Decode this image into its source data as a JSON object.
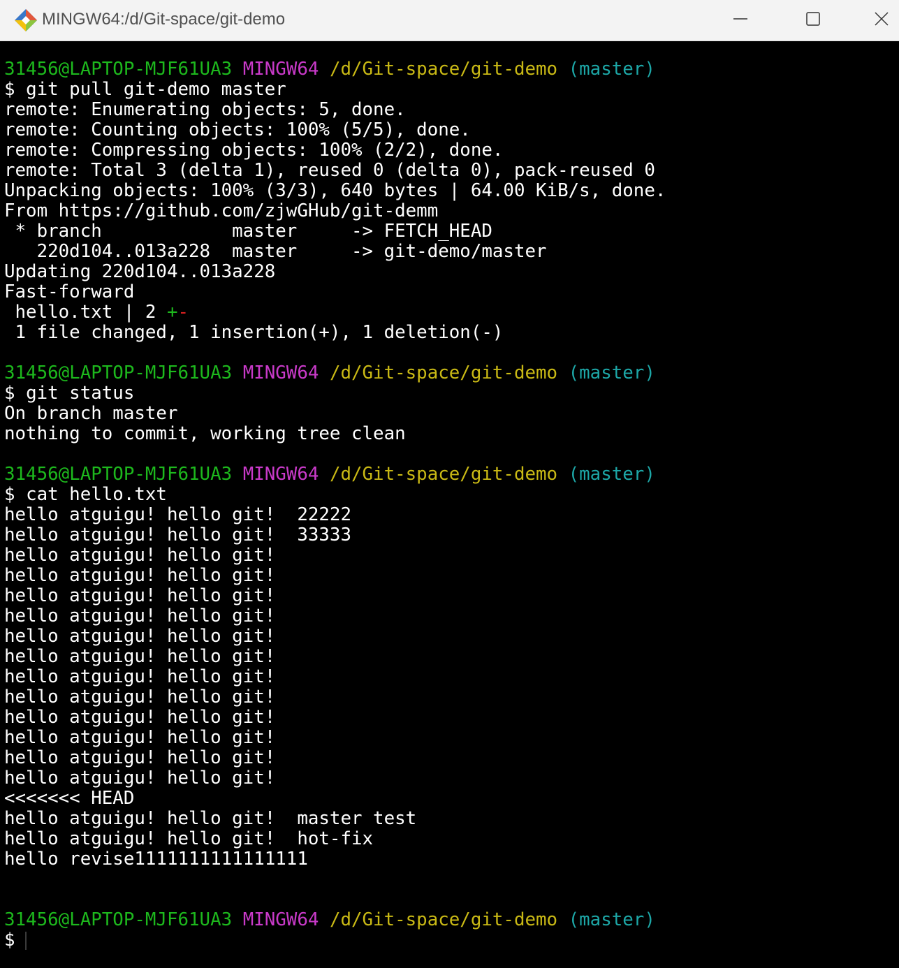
{
  "window": {
    "title": "MINGW64:/d/Git-space/git-demo",
    "app_icon": "git-logo-icon",
    "controls": [
      "minimize-icon",
      "maximize-icon",
      "close-icon"
    ]
  },
  "prompt": {
    "user_host": "31456@LAPTOP-MJF61UA3",
    "system": "MINGW64",
    "path": "/d/Git-space/git-demo",
    "branch": "(master)",
    "symbol": "$"
  },
  "blocks": [
    {
      "command": "git pull git-demo master",
      "output": [
        "remote: Enumerating objects: 5, done.",
        "remote: Counting objects: 100% (5/5), done.",
        "remote: Compressing objects: 100% (2/2), done.",
        "remote: Total 3 (delta 1), reused 0 (delta 0), pack-reused 0",
        "Unpacking objects: 100% (3/3), 640 bytes | 64.00 KiB/s, done.",
        "From https://github.com/zjwGHub/git-demm",
        " * branch            master     -> FETCH_HEAD",
        "   220d104..013a228  master     -> git-demo/master",
        "Updating 220d104..013a228",
        "Fast-forward"
      ],
      "diffstat": {
        "file_line": " hello.txt | 2 ",
        "plus": "+",
        "minus": "-"
      },
      "summary": " 1 file changed, 1 insertion(+), 1 deletion(-)"
    },
    {
      "command": "git status",
      "output": [
        "On branch master",
        "nothing to commit, working tree clean"
      ]
    },
    {
      "command": "cat hello.txt",
      "output": [
        "hello atguigu! hello git!  22222",
        "hello atguigu! hello git!  33333",
        "hello atguigu! hello git!",
        "hello atguigu! hello git!",
        "hello atguigu! hello git!",
        "hello atguigu! hello git!",
        "hello atguigu! hello git!",
        "hello atguigu! hello git!",
        "hello atguigu! hello git!",
        "hello atguigu! hello git!",
        "hello atguigu! hello git!",
        "hello atguigu! hello git!",
        "hello atguigu! hello git!",
        "hello atguigu! hello git!",
        "<<<<<<< HEAD",
        "hello atguigu! hello git!  master test",
        "hello atguigu! hello git!  hot-fix",
        "hello revise1111111111111111"
      ]
    }
  ],
  "colors": {
    "user_host": "#1db81d",
    "system": "#c93ac9",
    "path": "#c9b915",
    "branch": "#1da7a7",
    "text": "#ffffff",
    "background": "#000000"
  }
}
